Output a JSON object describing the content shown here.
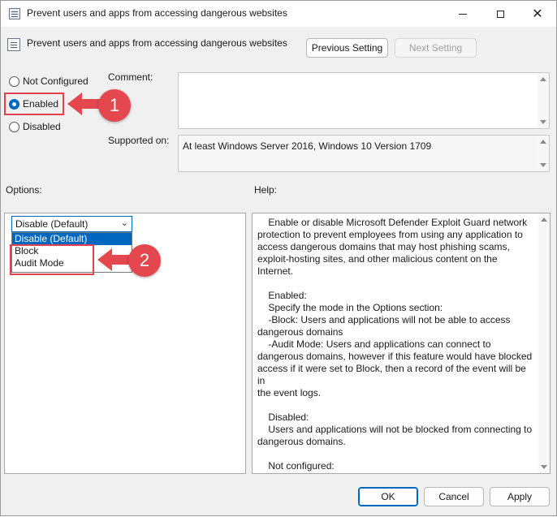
{
  "window": {
    "title": "Prevent users and apps from accessing dangerous websites",
    "close_glyph": "✕"
  },
  "header": {
    "policy_title": "Prevent users and apps from accessing dangerous websites",
    "previous_label": "Previous Setting",
    "next_label": "Next Setting"
  },
  "state": {
    "not_configured": "Not Configured",
    "enabled": "Enabled",
    "disabled": "Disabled",
    "selected": "enabled"
  },
  "comment_label": "Comment:",
  "comment_value": "",
  "supported_label": "Supported on:",
  "supported_value": "At least Windows Server 2016, Windows 10 Version 1709",
  "options_label": "Options:",
  "help_label": "Help:",
  "combo": {
    "value": "Disable (Default)",
    "arrow": "⌄",
    "options": [
      "Disable (Default)",
      "Block",
      "Audit Mode"
    ]
  },
  "help_text": "    Enable or disable Microsoft Defender Exploit Guard network\nprotection to prevent employees from using any application to\naccess dangerous domains that may host phishing scams,\nexploit-hosting sites, and other malicious content on the\nInternet.\n\n    Enabled:\n    Specify the mode in the Options section:\n    -Block: Users and applications will not be able to access\ndangerous domains\n    -Audit Mode: Users and applications can connect to\ndangerous domains, however if this feature would have blocked\naccess if it were set to Block, then a record of the event will be in\nthe event logs.\n\n    Disabled:\n    Users and applications will not be blocked from connecting to\ndangerous domains.\n\n    Not configured:\n    Same as Disabled.",
  "footer": {
    "ok": "OK",
    "cancel": "Cancel",
    "apply": "Apply"
  },
  "callouts": [
    {
      "number": "1"
    },
    {
      "number": "2"
    }
  ],
  "colors": {
    "accent": "#0067c0",
    "callout": "#e5474f"
  }
}
